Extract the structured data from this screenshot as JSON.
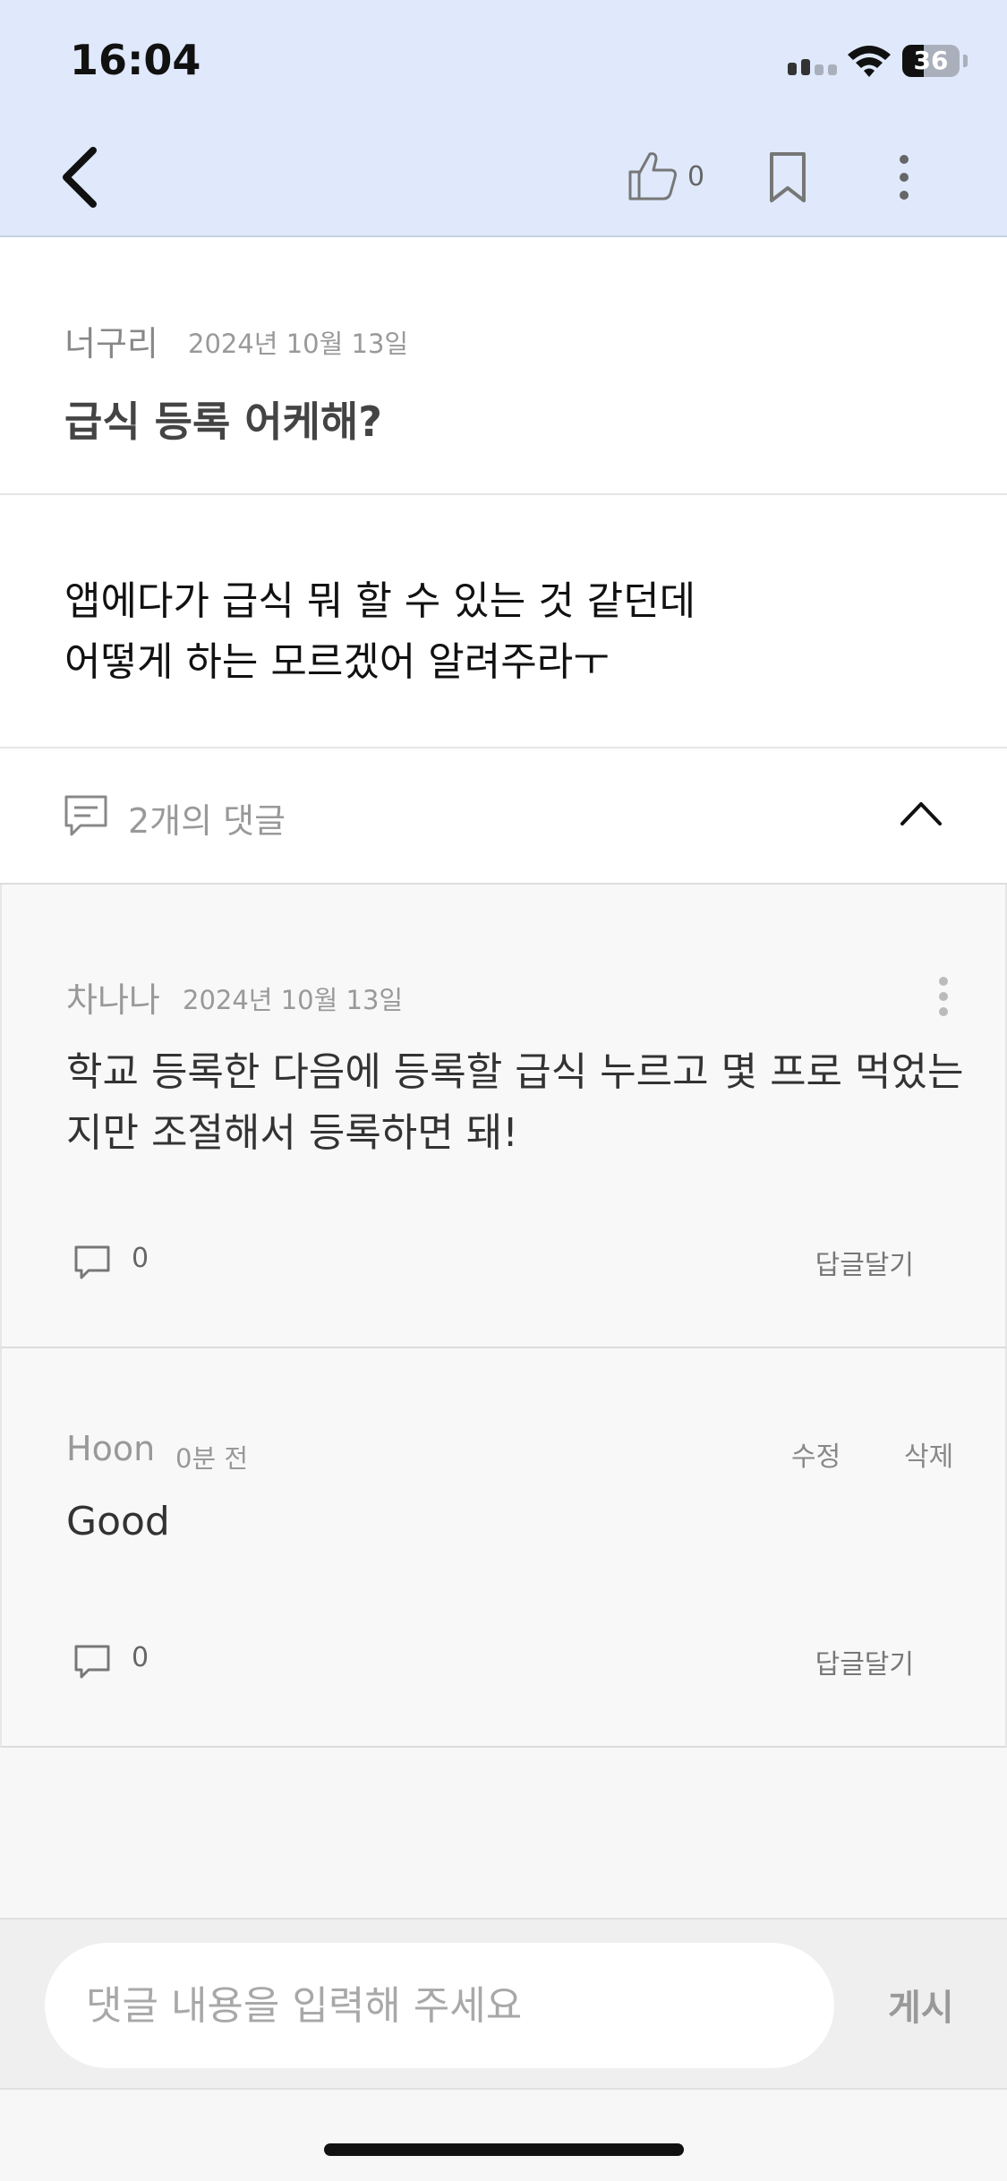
{
  "status_bar": {
    "time": "16:04",
    "battery": "36"
  },
  "nav": {
    "like_count": "0"
  },
  "post": {
    "author": "너구리",
    "date": "2024년 10월 13일",
    "title": "급식 등록 어케해?",
    "body_lines": [
      "앱에다가 급식 뭐 할 수 있는 것 같던데",
      "어떻게 하는 모르겠어 알려주라ㅜ"
    ]
  },
  "comments_header": {
    "label": "2개의 댓글"
  },
  "comments": [
    {
      "author": "차나나",
      "date": "2024년 10월 13일",
      "text_lines": [
        "학교 등록한 다음에 등록할 급식 누르고 몇 프로 먹었는",
        "지만 조절해서 등록하면 돼!"
      ],
      "reply_count": "0",
      "reply_label": "답글달기"
    },
    {
      "author": "Hoon",
      "date": "0분 전",
      "edit_label": "수정",
      "delete_label": "삭제",
      "text_lines": [
        "Good"
      ],
      "reply_count": "0",
      "reply_label": "답글달기"
    }
  ],
  "input": {
    "placeholder": "댓글 내용을 입력해 주세요",
    "post_label": "게시"
  }
}
